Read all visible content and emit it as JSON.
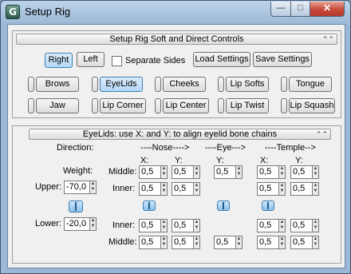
{
  "window": {
    "title": "Setup Rig",
    "app_icon": "G"
  },
  "controls_rollout": {
    "title": "Setup Rig Soft and Direct Controls",
    "side_buttons": {
      "right": "Right",
      "left": "Left"
    },
    "separate_sides": {
      "label": "Separate Sides",
      "checked": false
    },
    "load_settings": "Load Settings",
    "save_settings": "Save Settings",
    "row1": [
      "Brows",
      "EyeLids",
      "Cheeks",
      "Lip Softs",
      "Tongue"
    ],
    "row2": [
      "Jaw",
      "Lip Corner",
      "Lip Center",
      "Lip Twist",
      "Lip Squash"
    ],
    "active_button": "EyeLids"
  },
  "eyelids_rollout": {
    "title": "EyeLids: use X: and Y: to align eyelid bone chains",
    "direction_label": "Direction:",
    "nose_header": "----Nose---->",
    "eye_header": "----Eye--->",
    "temple_header": "----Temple-->",
    "x_label": "X:",
    "y_label": "Y:",
    "weight_label": "Weight:",
    "upper_label": "Upper:",
    "upper_value": "-70,0",
    "lower_label": "Lower:",
    "lower_value": "-20,0",
    "middle_label": "Middle:",
    "inner_label": "Inner:",
    "value": "0,5"
  },
  "colors": {
    "accent": "#b5d7f7",
    "window_frame": "#9cb8d6"
  }
}
